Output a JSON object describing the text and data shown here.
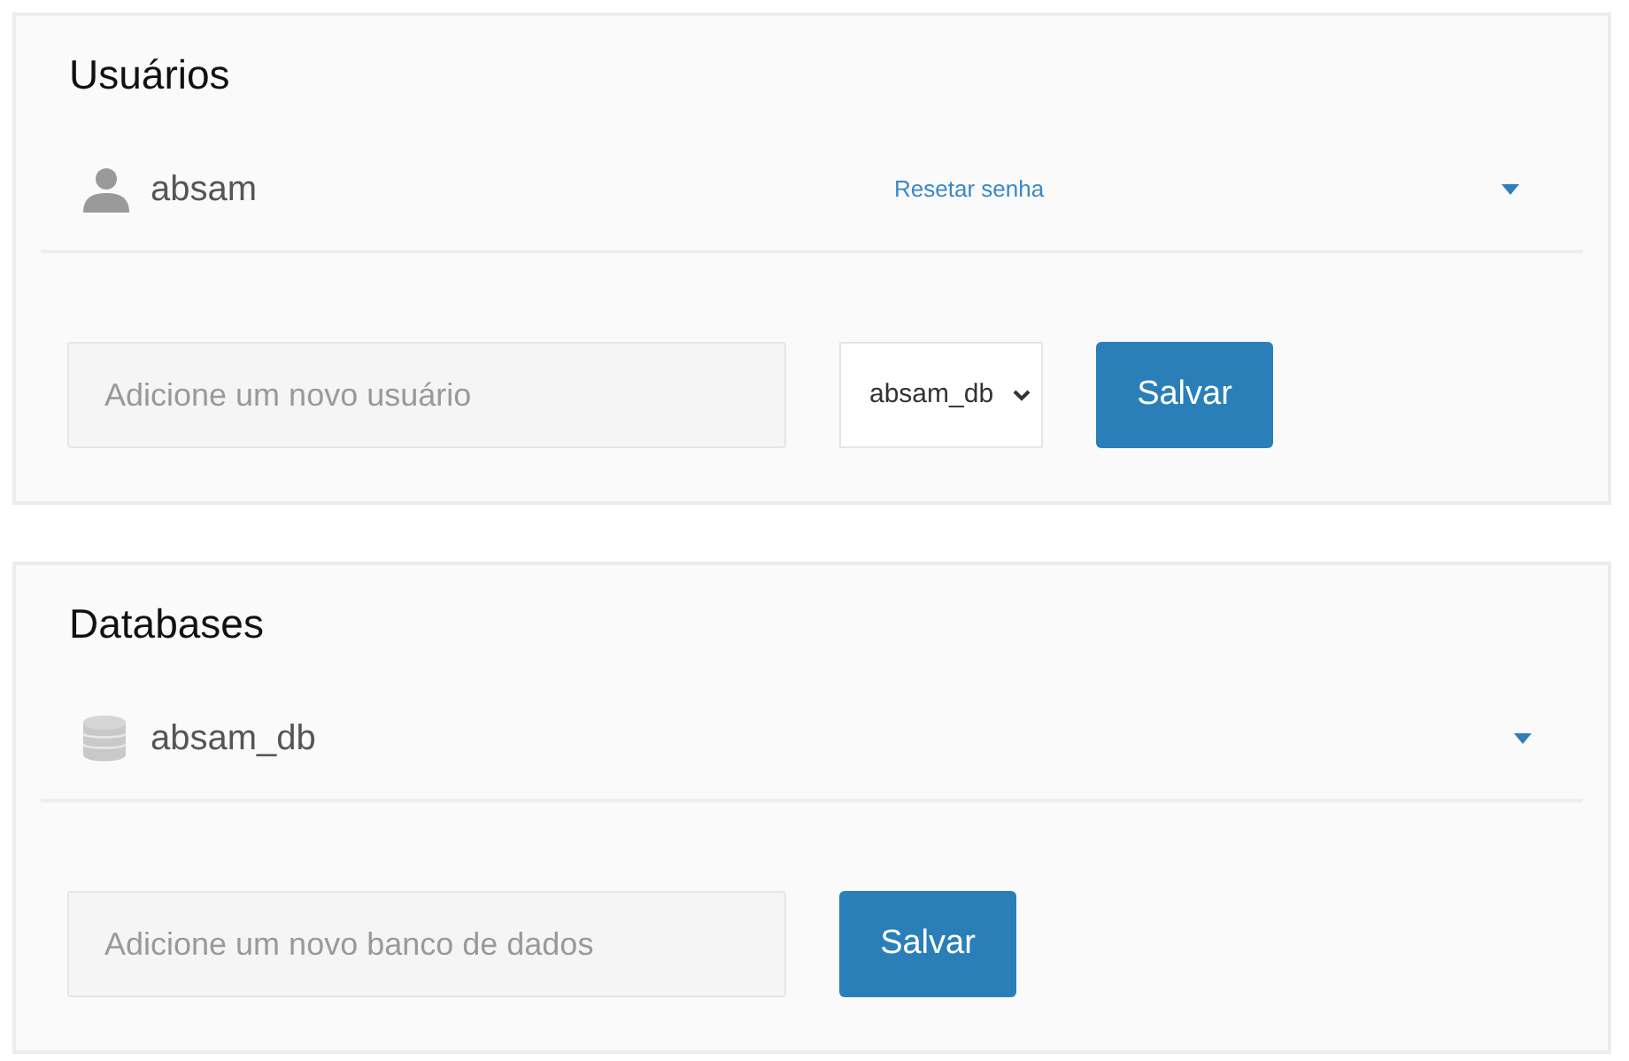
{
  "users": {
    "title": "Usuários",
    "items": [
      {
        "name": "absam",
        "action": "Resetar senha"
      }
    ],
    "new_user": {
      "placeholder": "Adicione um novo usuário",
      "database": "absam_db",
      "button": "Salvar"
    }
  },
  "databases": {
    "title": "Databases",
    "items": [
      {
        "name": "absam_db"
      }
    ],
    "new_database": {
      "placeholder": "Adicione um novo banco de dados",
      "button": "Salvar"
    }
  }
}
